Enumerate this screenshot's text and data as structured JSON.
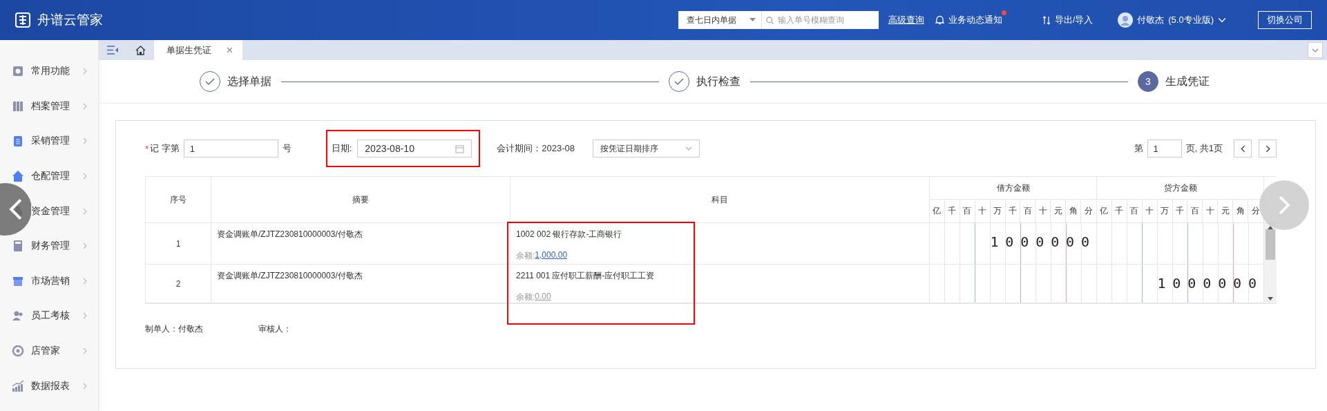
{
  "app": {
    "title": "舟谱云管家"
  },
  "header": {
    "range_select": "查七日内单据",
    "search": {
      "placeholder": "输入单号模糊查询"
    },
    "advanced_link": "高级查询",
    "notify": {
      "label": "业务动态通知",
      "unread": true
    },
    "export_import": "导出/导入",
    "user": {
      "name": "付敬杰",
      "edition": "(5.0专业版)"
    },
    "switch_button": "切换公司"
  },
  "sidebar": {
    "items": [
      {
        "label": "常用功能"
      },
      {
        "label": "档案管理"
      },
      {
        "label": "采销管理"
      },
      {
        "label": "仓配管理"
      },
      {
        "label": "资金管理"
      },
      {
        "label": "财务管理"
      },
      {
        "label": "市场营销"
      },
      {
        "label": "员工考核"
      },
      {
        "label": "店管家"
      },
      {
        "label": "数据报表"
      }
    ]
  },
  "tabs": [
    {
      "label": "单据生凭证",
      "selected": true
    }
  ],
  "steps": [
    {
      "label": "选择单据",
      "kind": "done"
    },
    {
      "label": "执行检查",
      "kind": "done"
    },
    {
      "label": "生成凭证",
      "kind": "current",
      "number": "3"
    }
  ],
  "form": {
    "voucher": {
      "required_mark": "*",
      "prefix": "记 字第",
      "value": "1",
      "suffix": "号"
    },
    "date": {
      "label": "日期:",
      "value": "2023-08-10",
      "highlighted": true
    },
    "period": "会计期间：2023-08",
    "sort": "按凭证日期排序",
    "page": {
      "prefix": "第",
      "value": "1",
      "suffix": "页, 共1页"
    }
  },
  "table": {
    "columns": [
      "序号",
      "摘要",
      "科目"
    ],
    "subjects_highlighted": true,
    "debit": {
      "title": "借方金额",
      "digits": [
        "亿",
        "千",
        "百",
        "十",
        "万",
        "千",
        "百",
        "十",
        "元",
        "角",
        "分"
      ]
    },
    "credit": {
      "title": "贷方金额",
      "digits": [
        "亿",
        "千",
        "百",
        "十",
        "万",
        "千",
        "百",
        "十",
        "元",
        "角",
        "分"
      ]
    },
    "rows": [
      {
        "index": "1",
        "summary": "资金调账单/ZJTZ230810000003/付敬杰",
        "subject": "1002 002 银行存款-工商银行",
        "balance_label": "余额:",
        "balance": "1,000.00",
        "balance_linked": true,
        "debit": "1000000"
      },
      {
        "index": "2",
        "summary": "资金调账单/ZJTZ230810000003/付敬杰",
        "subject": "2211 001 应付职工薪酬-应付职工工资",
        "balance_label": "余额:",
        "balance": "0.00",
        "balance_linked": false,
        "credit": "1000000"
      }
    ]
  },
  "footer": {
    "maker": "制单人：付敬杰",
    "reviewer": "审核人："
  },
  "carousel": {
    "prev": true,
    "next": true
  }
}
